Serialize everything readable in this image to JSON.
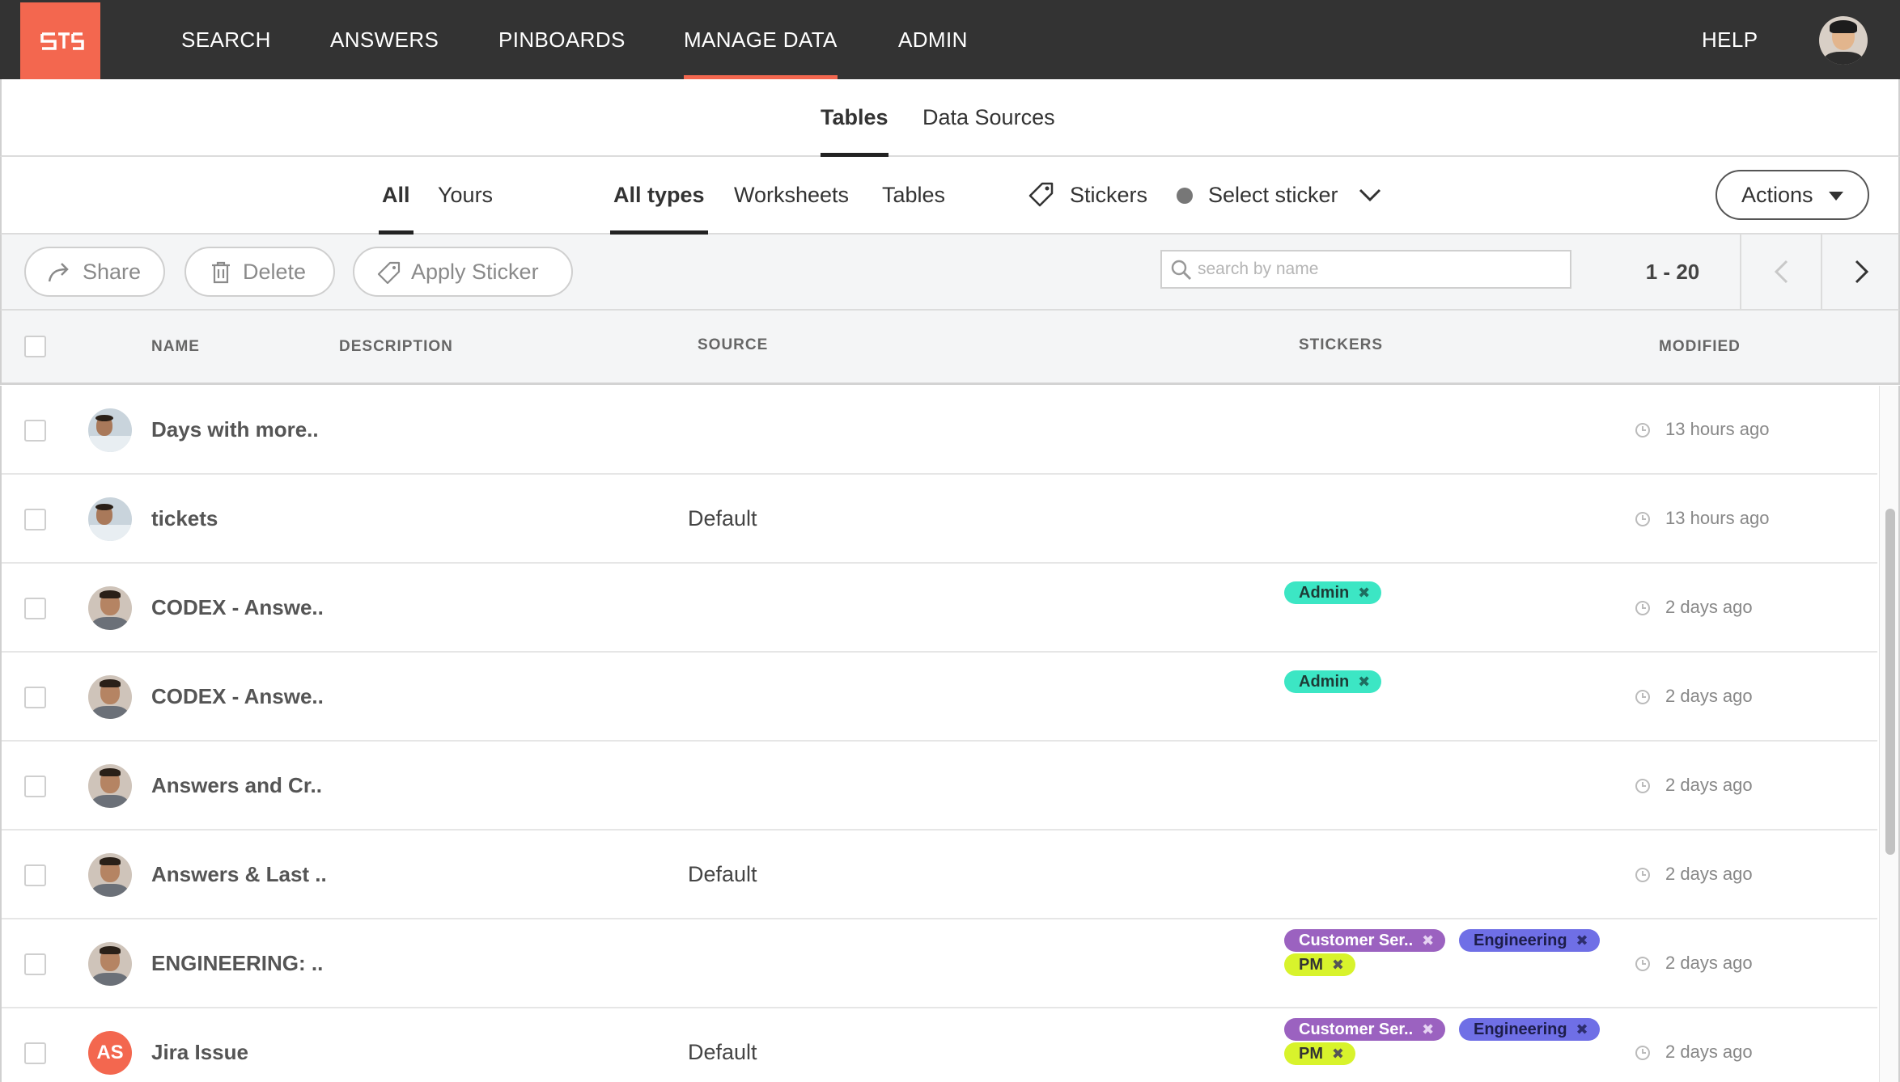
{
  "nav": {
    "items": [
      "SEARCH",
      "ANSWERS",
      "PINBOARDS",
      "MANAGE DATA",
      "ADMIN"
    ],
    "active": "MANAGE DATA",
    "help": "HELP",
    "accent": "#f3674f",
    "background": "#333333"
  },
  "subtabs": {
    "tables": "Tables",
    "data_sources": "Data Sources",
    "active": "Tables"
  },
  "filters": {
    "owner": {
      "all": "All",
      "yours": "Yours"
    },
    "types": {
      "all_types": "All types",
      "worksheets": "Worksheets",
      "tables": "Tables"
    },
    "stickers_label": "Stickers",
    "select_sticker": "Select sticker",
    "actions": "Actions"
  },
  "toolbar": {
    "share": "Share",
    "delete": "Delete",
    "apply_sticker": "Apply Sticker",
    "search_placeholder": "search by name",
    "page_range": "1 - 20"
  },
  "table": {
    "headers": {
      "name": "NAME",
      "description": "DESCRIPTION",
      "source": "SOURCE",
      "stickers": "STICKERS",
      "modified": "MODIFIED"
    },
    "rows": [
      {
        "name": "Days with more..",
        "source": "",
        "stickers": [],
        "modified": "13 hours ago",
        "avatar": "photo-wide"
      },
      {
        "name": "tickets",
        "source": "Default",
        "stickers": [],
        "modified": "13 hours ago",
        "avatar": "photo-wide"
      },
      {
        "name": "CODEX - Answe..",
        "source": "",
        "stickers": [
          "Admin"
        ],
        "modified": "2 days ago",
        "avatar": "photo"
      },
      {
        "name": "CODEX - Answe..",
        "source": "",
        "stickers": [
          "Admin"
        ],
        "modified": "2 days ago",
        "avatar": "photo"
      },
      {
        "name": "Answers and Cr..",
        "source": "",
        "stickers": [],
        "modified": "2 days ago",
        "avatar": "photo"
      },
      {
        "name": "Answers & Last ..",
        "source": "Default",
        "stickers": [],
        "modified": "2 days ago",
        "avatar": "photo"
      },
      {
        "name": "ENGINEERING: ..",
        "source": "",
        "stickers": [
          "Customer Ser..",
          "Engineering",
          "PM"
        ],
        "modified": "2 days ago",
        "avatar": "photo"
      },
      {
        "name": "Jira Issue",
        "source": "Default",
        "stickers": [
          "Customer Ser..",
          "Engineering",
          "PM"
        ],
        "modified": "2 days ago",
        "avatar": "initials",
        "initials": "AS"
      }
    ]
  },
  "sticker_colors": {
    "Admin": "#3ce6c4",
    "Customer Ser..": "#9b62c0",
    "Engineering": "#6f6fe6",
    "PM": "#d8f32c"
  }
}
